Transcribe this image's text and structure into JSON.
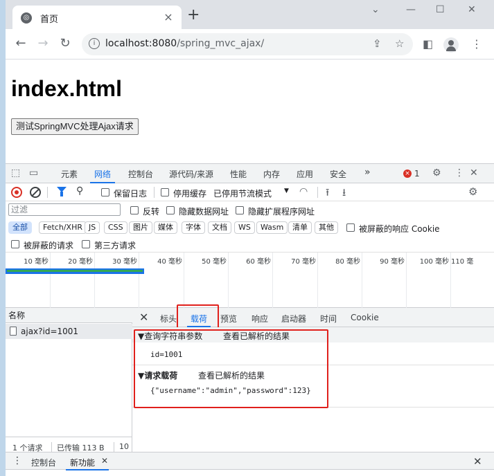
{
  "browser": {
    "tab_title": "首页",
    "tab_favicon": "globe-icon",
    "url_host": "localhost:8080",
    "url_path": "/spring_mvc_ajax/"
  },
  "page": {
    "heading": "index.html",
    "button_label": "测试SpringMVC处理Ajax请求"
  },
  "devtools": {
    "tabs": [
      "元素",
      "网络",
      "控制台",
      "源代码/来源",
      "性能",
      "内存",
      "应用",
      "安全"
    ],
    "active_tab": "网络",
    "more_tabs": "»",
    "error_count": "1",
    "toolbar": {
      "preserve_log": "保留日志",
      "disable_cache": "停用缓存",
      "throttle": "已停用节流模式"
    },
    "filter": {
      "placeholder": "过滤",
      "invert": "反转",
      "hide_data_urls": "隐藏数据网址",
      "hide_extension_urls": "隐藏扩展程序网址"
    },
    "types": [
      "全部",
      "Fetch/XHR",
      "JS",
      "CSS",
      "图片",
      "媒体",
      "字体",
      "文档",
      "WS",
      "Wasm",
      "清单",
      "其他"
    ],
    "active_type": "全部",
    "blocked_cookies": "被屏蔽的响应 Cookie",
    "blocked_requests": "被屏蔽的请求",
    "third_party": "第三方请求",
    "timeline_ticks": [
      "10 毫秒",
      "20 毫秒",
      "30 毫秒",
      "40 毫秒",
      "50 毫秒",
      "60 毫秒",
      "70 毫秒",
      "80 毫秒",
      "90 毫秒",
      "100 毫秒",
      "110 毫"
    ],
    "name_header": "名称",
    "requests": [
      {
        "name": "ajax?id=1001"
      }
    ],
    "status": {
      "requests": "1 个请求",
      "transferred": "已传输 113 B",
      "more": "10"
    },
    "detail_tabs": [
      "标头",
      "载荷",
      "预览",
      "响应",
      "启动器",
      "时间",
      "Cookie"
    ],
    "active_detail_tab": "载荷",
    "query_section": {
      "title": "▼查询字符串参数",
      "link": "查看已解析的结果",
      "value": "id=1001"
    },
    "payload_section": {
      "title": "▼请求载荷",
      "link": "查看已解析的结果",
      "value": "{\"username\":\"admin\",\"password\":123}"
    },
    "drawer": {
      "tabs": [
        "控制台",
        "新功能"
      ],
      "active": "新功能"
    }
  }
}
